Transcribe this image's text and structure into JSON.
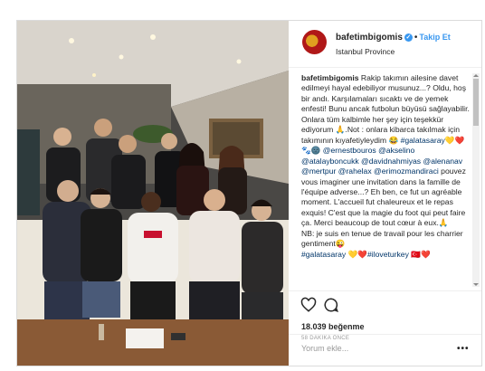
{
  "post": {
    "username": "bafetimbigomis",
    "verified": "✓",
    "separator": "•",
    "follow_label": "Takip Et",
    "location": "Istanbul Province"
  },
  "caption": {
    "author": "bafetimbigomis",
    "turkish": "Rakip takımın ailesine davet edilmeyi hayal edebiliyor musunuz...? Oldu, hoş bir andı. Karşılamaları sıcaktı ve de yemek enfesti! Bunu ancak futbolun büyüsü sağlayabilir. Onlara tüm kalbimle her şey için teşekkür ediyorum 🙏.Not : onlara kibarca takılmak için takımının kıyafetiyleydim 😂",
    "hashtag1": "#galatasaray",
    "emojis1": "💛❤️🐾🌚",
    "mentions": "@ernestbouros @akselino @atalayboncukk @davidnahmiyas @alenanav @mertpur @rahelax @erimozmandiraci",
    "french": "pouvez vous imaginer une invitation dans la famille de l'équipe adverse...? Eh ben, ce fut un agréable moment. L'accueil fut chaleureux et le repas exquis! C'est que la magie du foot qui peut faire ça. Merci beaucoup de tout cœur à eux.🙏",
    "note": "NB: je suis en tenue de travail pour les charrier gentiment😜",
    "hashtag2": "#galatasaray",
    "emojis2": "💛❤️",
    "hashtag3": "#iloveturkey",
    "emojis3": "🇹🇷❤️"
  },
  "actions": {
    "like_icon": "heart-outline-icon",
    "comment_icon": "speech-bubble-icon",
    "likes": "18.039 beğenme",
    "time": "58 DAKİKA ÖNCE"
  },
  "comment": {
    "placeholder": "Yorum ekle...",
    "more_label": "•••"
  }
}
